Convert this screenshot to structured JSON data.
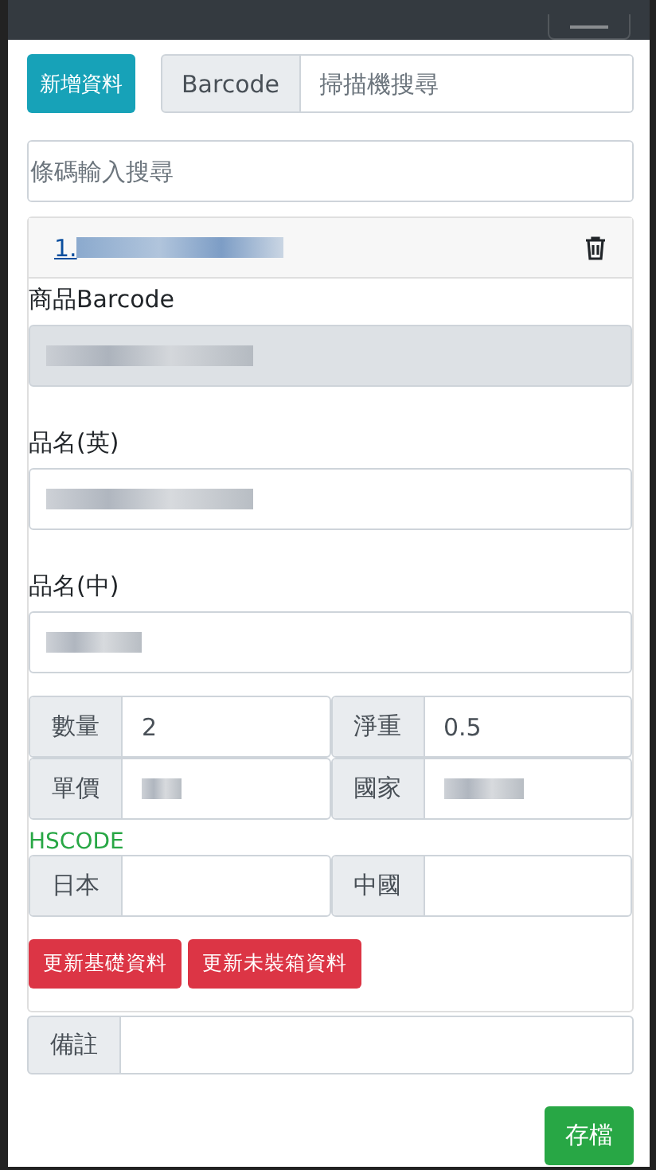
{
  "toolbar": {
    "add_button": "新增資料",
    "scan": {
      "addon": "Barcode",
      "placeholder": "掃描機搜尋"
    }
  },
  "search": {
    "placeholder": "條碼輸入搜尋"
  },
  "item": {
    "link": "1.",
    "blurred": true,
    "fields": [
      {
        "label": "商品Barcode",
        "disabled": true,
        "blurred": true
      },
      {
        "label": "品名(英)",
        "disabled": false,
        "blurred": true
      },
      {
        "label": "品名(中)",
        "disabled": false,
        "blurred": true
      }
    ],
    "grid": [
      {
        "label": "數量",
        "value": "2",
        "blurred": false
      },
      {
        "label": "淨重",
        "value": "0.5",
        "blurred": false
      },
      {
        "label": "單價",
        "blurred": true
      },
      {
        "label": "國家",
        "blurred": true
      }
    ],
    "hscode_title": "HSCODE",
    "hscode": [
      {
        "label": "日本"
      },
      {
        "label": "中國"
      }
    ],
    "buttons": [
      "更新基礎資料",
      "更新未裝箱資料"
    ]
  },
  "note": {
    "label": "備註"
  },
  "save_button": "存檔"
}
